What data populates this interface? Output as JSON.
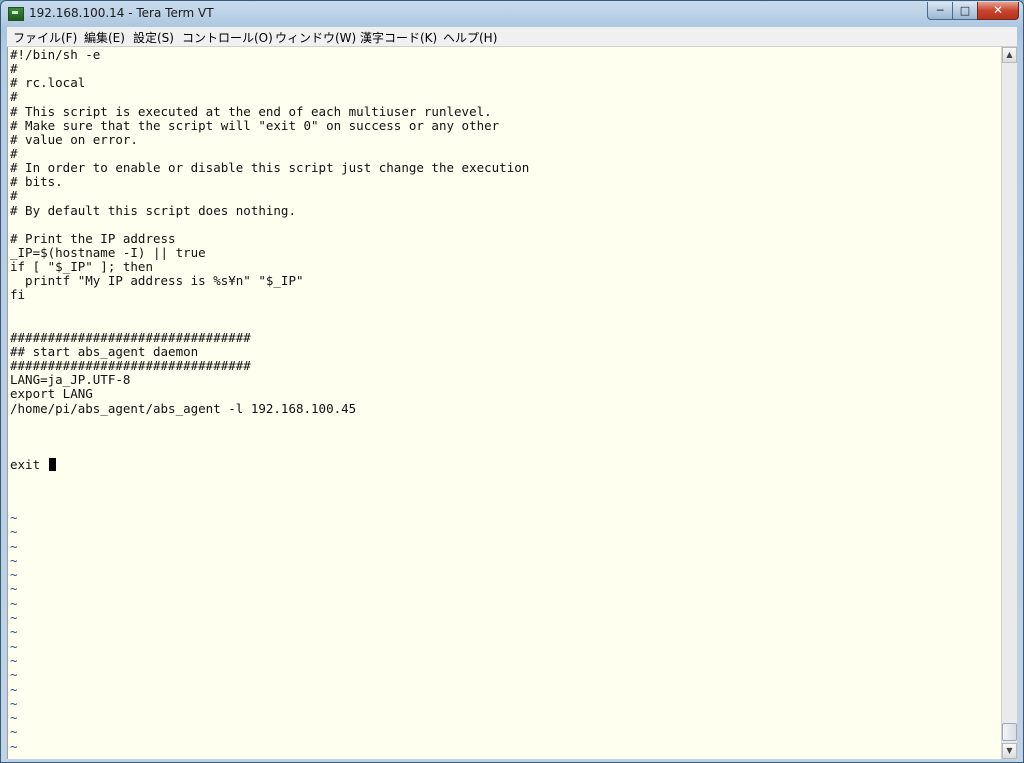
{
  "window": {
    "title": "192.168.100.14 - Tera Term VT",
    "minimize_glyph": "─",
    "maximize_glyph": "□",
    "close_glyph": "✕"
  },
  "menu": [
    {
      "label": "ファイル(F)"
    },
    {
      "label": "編集(E)"
    },
    {
      "label": "設定(S)"
    },
    {
      "label": "コントロール(O)"
    },
    {
      "label": "ウィンドウ(W)"
    },
    {
      "label": "漢字コード(K)"
    },
    {
      "label": "ヘルプ(H)"
    }
  ],
  "terminal": {
    "lines": [
      "#!/bin/sh -e",
      "#",
      "# rc.local",
      "#",
      "# This script is executed at the end of each multiuser runlevel.",
      "# Make sure that the script will \"exit 0\" on success or any other",
      "# value on error.",
      "#",
      "# In order to enable or disable this script just change the execution",
      "# bits.",
      "#",
      "# By default this script does nothing.",
      "",
      "# Print the IP address",
      "_IP=$(hostname -I) || true",
      "if [ \"$_IP\" ]; then",
      "  printf \"My IP address is %s¥n\" \"$_IP\"",
      "fi",
      "",
      "",
      "################################",
      "## start abs_agent daemon",
      "################################",
      "LANG=ja_JP.UTF-8",
      "export LANG",
      "/home/pi/abs_agent/abs_agent -l 192.168.100.45",
      "",
      "",
      "",
      "exit "
    ],
    "cursor_char": "0",
    "tilde": "~",
    "tilde_count": 18,
    "background": "#fffff0",
    "text_color": "#111111",
    "tilde_color": "#2a4a8a"
  },
  "scrollbar": {
    "up_glyph": "▲",
    "down_glyph": "▼"
  }
}
